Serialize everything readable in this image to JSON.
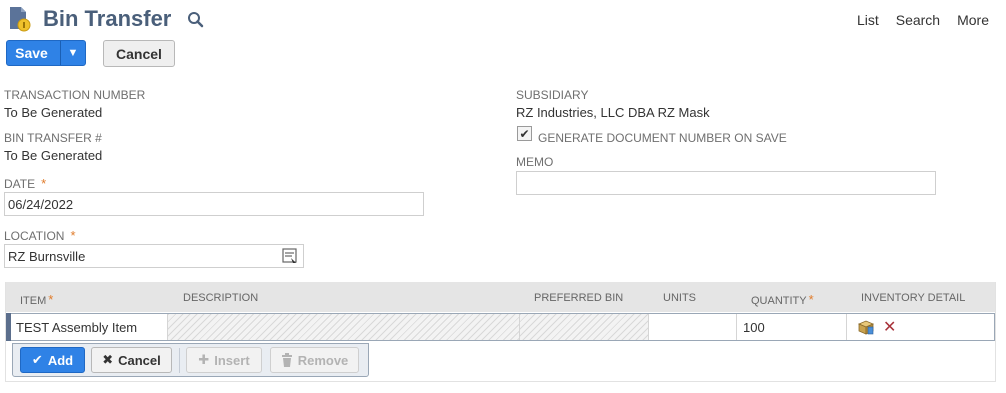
{
  "header": {
    "title": "Bin Transfer",
    "links": [
      "List",
      "Search",
      "More"
    ]
  },
  "toolbar": {
    "save_label": "Save",
    "cancel_label": "Cancel"
  },
  "fields": {
    "transaction_number": {
      "label": "Transaction Number",
      "value": "To Be Generated"
    },
    "bin_transfer_no": {
      "label": "Bin Transfer #",
      "value": "To Be Generated"
    },
    "date": {
      "label": "Date",
      "value": "06/24/2022",
      "required": "*"
    },
    "location": {
      "label": "Location",
      "value": "RZ Burnsville",
      "required": "*"
    },
    "subsidiary": {
      "label": "Subsidiary",
      "value": "RZ Industries, LLC DBA RZ Mask"
    },
    "generate_doc": {
      "label": "Generate Document Number On Save",
      "checked": true
    },
    "memo": {
      "label": "Memo",
      "value": ""
    }
  },
  "sublist": {
    "columns": [
      "Item",
      "Description",
      "Preferred Bin",
      "Units",
      "Quantity",
      "Inventory Detail"
    ],
    "required_marker": "*",
    "row": {
      "item": "TEST Assembly Item",
      "description": "",
      "preferred_bin": "",
      "units": "",
      "quantity": "100"
    },
    "actions": {
      "add": "Add",
      "cancel": "Cancel",
      "insert": "Insert",
      "remove": "Remove"
    }
  },
  "colors": {
    "accent": "#2f82e6",
    "title": "#4a5f7a",
    "required": "#e07b2a"
  },
  "icons": [
    "record-page-icon",
    "search-icon",
    "dropdown-arrow-icon",
    "location-picker-icon",
    "check-icon",
    "inventory-detail-icon",
    "delete-icon",
    "x-icon",
    "plus-icon",
    "trash-icon"
  ]
}
